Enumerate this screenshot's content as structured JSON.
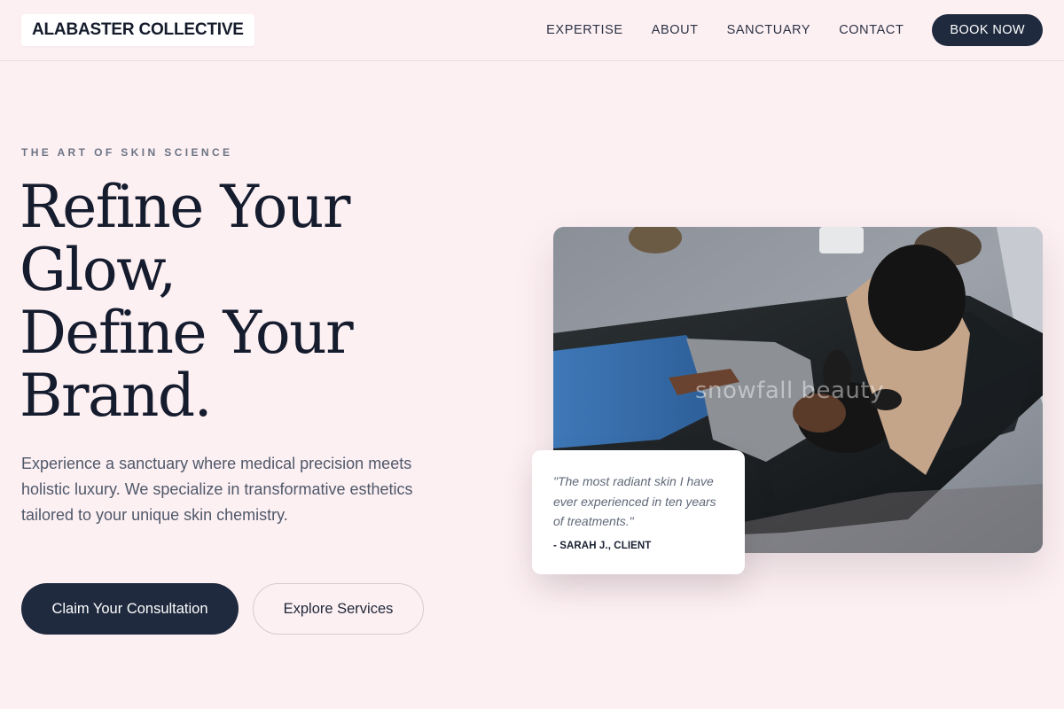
{
  "brand": {
    "name": "ALABASTER COLLECTIVE"
  },
  "nav": {
    "items": [
      "EXPERTISE",
      "ABOUT",
      "SANCTUARY",
      "CONTACT"
    ],
    "cta": "BOOK NOW"
  },
  "hero": {
    "eyebrow": "THE ART OF SKIN SCIENCE",
    "headline_lines": [
      "Refine Your",
      "Glow,",
      "Define Your",
      "Brand."
    ],
    "lede": "Experience a sanctuary where medical precision meets holistic luxury. We specialize in transformative esthetics tailored to your unique skin chemistry.",
    "primary_cta": "Claim Your Consultation",
    "secondary_cta": "Explore Services"
  },
  "image": {
    "watermark": "snowfall beauty"
  },
  "testimonial": {
    "quote": "\"The most radiant skin I have ever experienced in ten years of treatments.\"",
    "author": "- SARAH J., CLIENT"
  },
  "colors": {
    "background": "#fdf0f3",
    "primary": "#1f2a3e",
    "text": "#151c2e",
    "muted": "#4f5869"
  }
}
